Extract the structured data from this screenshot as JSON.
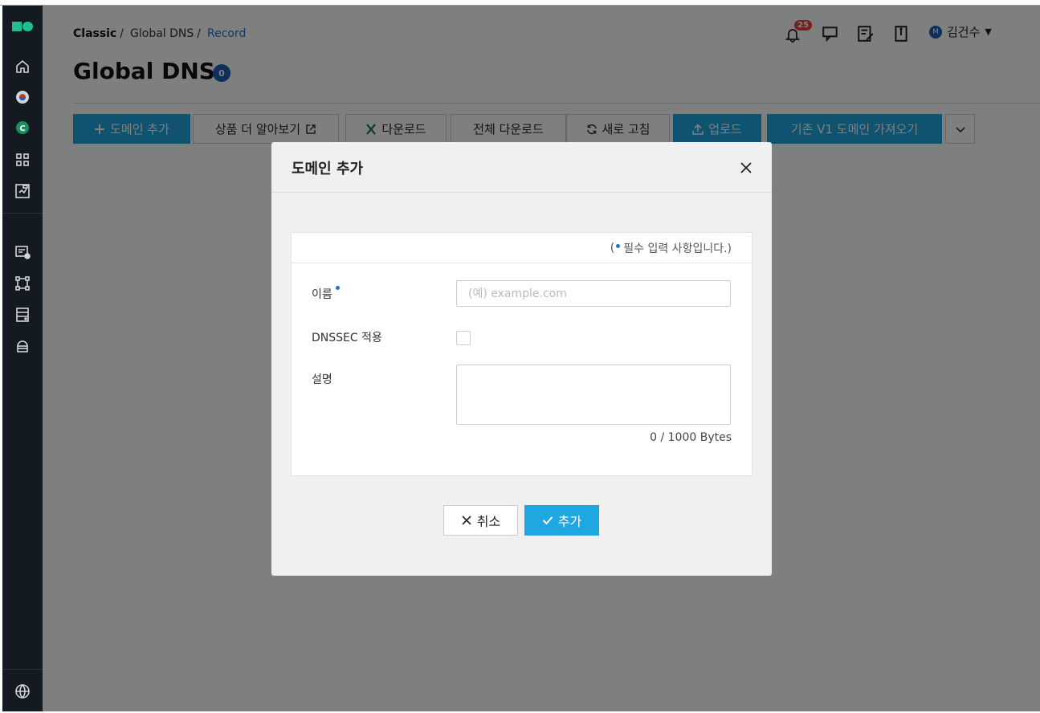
{
  "breadcrumb": {
    "root": "Classic",
    "middle": "Global DNS",
    "current": "Record",
    "separator": "/"
  },
  "page": {
    "title": "Global DNS",
    "badge_count": "0"
  },
  "header": {
    "notification_count": "25",
    "user_initial": "M",
    "user_name": "김건수",
    "user_caret": "▼"
  },
  "toolbar": {
    "add_domain": "도메인 추가",
    "learn_more": "상품 더 알아보기",
    "download": "다운로드",
    "download_all": "전체 다운로드",
    "refresh": "새로 고침",
    "upload": "업로드",
    "import_v1": "기존 V1 도메인 가져오기"
  },
  "modal": {
    "title": "도메인 추가",
    "required_note_open": "(",
    "required_note_text": "필수 입력 사항입니다.)",
    "name_label": "이름",
    "name_placeholder": "(예) example.com",
    "dnssec_label": "DNSSEC 적용",
    "description_label": "설명",
    "bytes_counter": "0 / 1000 Bytes",
    "cancel_label": "취소",
    "ok_label": "추가"
  },
  "colors": {
    "primary": "#1ea7e1",
    "sidebar_bg": "#141a21",
    "accent_blue": "#1a73c4",
    "badge_red": "#e8453c",
    "logo_green": "#1fbf8f"
  },
  "icons": {
    "sidebar": [
      "home-icon",
      "korea-flag-icon",
      "classic-c-icon",
      "apps-grid-icon",
      "dashboard-icon",
      "server-monitor-icon",
      "network-nodes-icon",
      "storage-icon",
      "cloud-db-icon",
      "globe-icon"
    ],
    "header": [
      "bell-icon",
      "chat-icon",
      "edit-note-icon",
      "book-icon"
    ]
  }
}
